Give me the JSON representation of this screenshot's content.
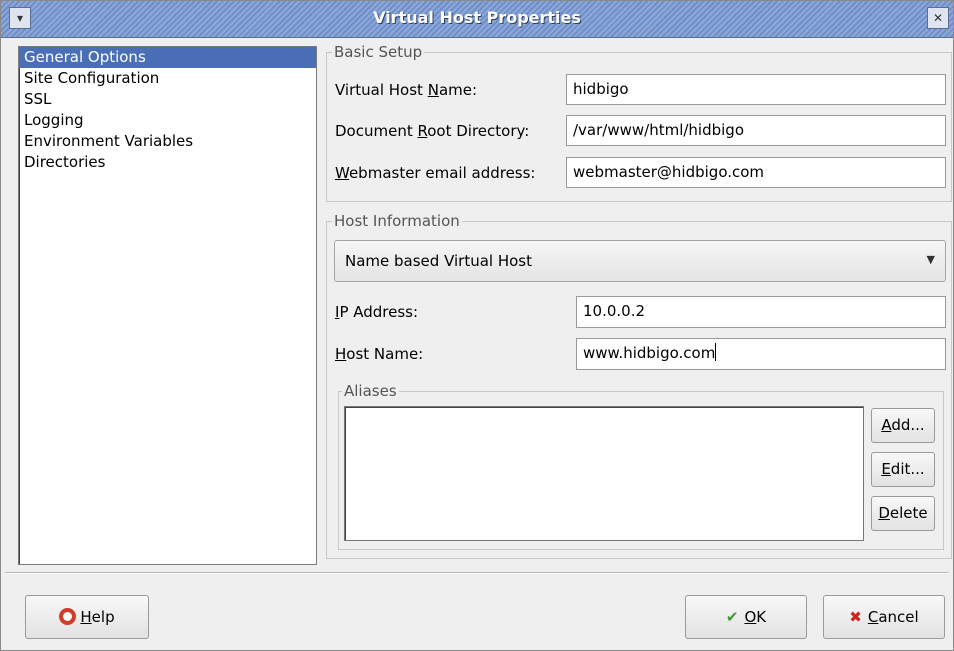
{
  "window": {
    "title": "Virtual Host Properties",
    "menu_glyph": "▾",
    "close_glyph": "✕"
  },
  "sidebar": {
    "items": [
      {
        "label": "General Options",
        "selected": true
      },
      {
        "label": "Site Configuration"
      },
      {
        "label": "SSL"
      },
      {
        "label": "Logging"
      },
      {
        "label": "Environment Variables"
      },
      {
        "label": "Directories"
      }
    ]
  },
  "basic_setup": {
    "title": "Basic Setup",
    "vhost_name_label": {
      "pre": "Virtual Host ",
      "u": "N",
      "post": "ame:"
    },
    "vhost_name_value": "hidbigo",
    "docroot_label": {
      "pre": "Document ",
      "u": "R",
      "post": "oot Directory:"
    },
    "docroot_value": "/var/www/html/hidbigo",
    "webmaster_label": {
      "pre": "",
      "u": "W",
      "post": "ebmaster email address:"
    },
    "webmaster_value": "webmaster@hidbigo.com"
  },
  "host_info": {
    "title": "Host Information",
    "type_selected": "Name based Virtual Host",
    "ip_label": {
      "pre": "",
      "u": "I",
      "post": "P Address:"
    },
    "ip_value": "10.0.0.2",
    "hostname_label": {
      "pre": "",
      "u": "H",
      "post": "ost Name:"
    },
    "hostname_value": "www.hidbigo.com"
  },
  "aliases": {
    "title": "Aliases",
    "add": {
      "pre": "",
      "u": "A",
      "post": "dd..."
    },
    "edit": {
      "pre": "",
      "u": "E",
      "post": "dit..."
    },
    "delete": {
      "pre": "",
      "u": "D",
      "post": "elete"
    }
  },
  "footer": {
    "help": {
      "pre": "",
      "u": "H",
      "post": "elp"
    },
    "ok": {
      "pre": "",
      "u": "O",
      "post": "K"
    },
    "cancel": {
      "pre": "",
      "u": "C",
      "post": "ancel"
    }
  },
  "colors": {
    "selection": "#4b6fb7",
    "titlebar": "#7b98cf"
  }
}
